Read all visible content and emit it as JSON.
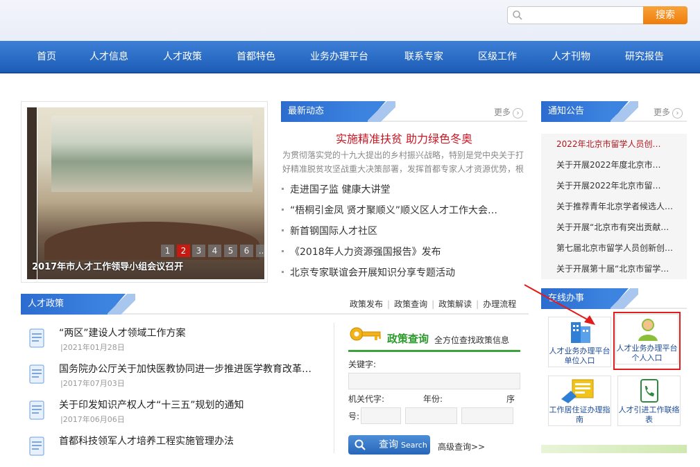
{
  "search": {
    "placeholder": "",
    "button_label": "搜索"
  },
  "nav": [
    "首页",
    "人才信息",
    "人才政策",
    "首都特色",
    "业务办理平台",
    "联系专家",
    "区级工作",
    "人才刊物",
    "研究报告"
  ],
  "slider": {
    "caption": "2017年市人才工作领导小组会议召开",
    "pages": [
      "1",
      "2",
      "3",
      "4",
      "5",
      "6",
      "..."
    ],
    "active_page": "2"
  },
  "latest": {
    "title": "最新动态",
    "more": "更多",
    "headline": "实施精准扶贫 助力绿色冬奥",
    "summary": "为贯彻落实党的十九大提出的乡村振兴战略，特别是党中央关于打好精准脱贫攻坚战重大决策部署，发挥首都专家人才资源优势，根",
    "items": [
      "走进国子监  健康大讲堂",
      "“梧桐引金凤 贤才聚顺义”顺义区人才工作大会…",
      "新首钢国际人才社区",
      "《2018年人力资源强国报告》发布",
      "北京专家联谊会开展知识分享专题活动"
    ]
  },
  "notices": {
    "title": "通知公告",
    "more": "更多",
    "items": [
      "2022年北京市留学人员创…",
      "关于开展2022年度北京市…",
      "关于开展2022年北京市留…",
      "关于推荐青年北京学者候选人…",
      "关于开展“北京市有突出贡献…",
      "第七届北京市留学人员创新创…",
      "关于开展第十届“北京市留学…"
    ]
  },
  "policy": {
    "title": "人才政策",
    "links": [
      "政策发布",
      "政策查询",
      "政策解读",
      "办理流程"
    ],
    "items": [
      {
        "title": "“两区”建设人才领域工作方案",
        "date": "|2021年01月28日"
      },
      {
        "title": "国务院办公厅关于加快医教协同进一步推进医学教育改革…",
        "date": "|2017年07月03日"
      },
      {
        "title": "关于印发知识产权人才“十三五”规划的通知",
        "date": "|2017年06月06日"
      },
      {
        "title": "首都科技领军人才培养工程实施管理办法",
        "date": ""
      }
    ]
  },
  "query": {
    "title": "政策查询",
    "subtitle": "全方位查找政策信息",
    "keyword_label": "关键字:",
    "org_label": "机关代字:",
    "year_label": "年份:",
    "seq_label": "序",
    "num_label": "号:",
    "button_label": "查询",
    "button_sub": "Search",
    "advanced": "高级查询>>"
  },
  "online": {
    "title": "在线办事",
    "services": [
      {
        "label": "人才业务办理平台单位入口"
      },
      {
        "label": "人才业务办理平台个人入口"
      },
      {
        "label": "工作居住证办理指南"
      },
      {
        "label": "人才引进工作联络表"
      }
    ]
  },
  "colors": {
    "nav_blue": "#2a6bc8",
    "accent_red": "#c81623",
    "orange": "#ef7d0b",
    "highlight": "#e21b1b"
  }
}
